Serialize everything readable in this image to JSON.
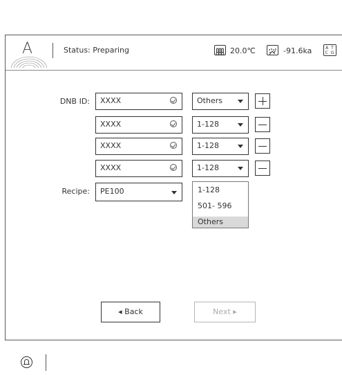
{
  "header": {
    "status_text": "Status: Preparing",
    "temperature": "20.0℃",
    "pressure": "-91.6ka",
    "atcg_line1": "A T",
    "atcg_line2": "C G",
    "logo_letter": "A"
  },
  "form": {
    "dnb_label": "DNB ID:",
    "recipe_label": "Recipe:",
    "rows": [
      {
        "id": "XXXX",
        "range": "Others",
        "action": "add"
      },
      {
        "id": "XXXX",
        "range": "1-128",
        "action": "remove"
      },
      {
        "id": "XXXX",
        "range": "1-128",
        "action": "remove"
      },
      {
        "id": "XXXX",
        "range": "1-128",
        "action": "remove"
      }
    ],
    "recipe_value": "PE100",
    "dropdown_options": [
      "1-128",
      "501- 596",
      "Others"
    ],
    "dropdown_selected": "Others"
  },
  "nav": {
    "back_label": "◂ Back",
    "next_label": "Next ▸"
  }
}
